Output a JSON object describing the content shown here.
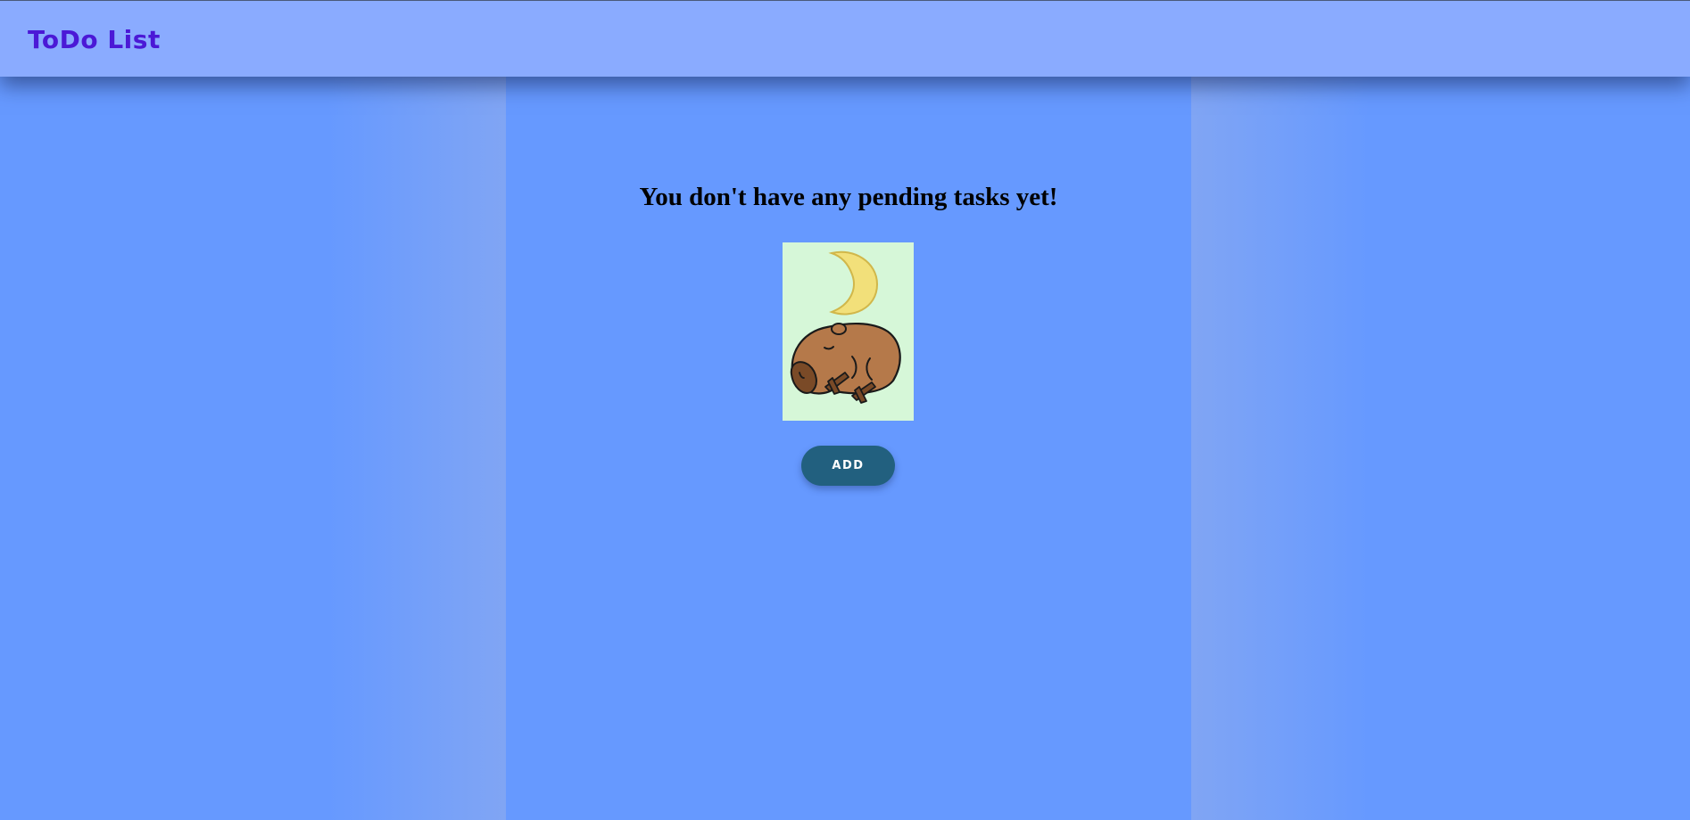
{
  "header": {
    "title": "ToDo List"
  },
  "main": {
    "empty_message": "You don't have any pending tasks yet!",
    "illustration": {
      "icon": "sleeping-capybara-moon-illustration"
    },
    "add_button_label": "ADD"
  },
  "colors": {
    "page_background": "#6699ff",
    "header_background": "#8aabff",
    "title_color": "#4b19d6",
    "button_background": "#22607f",
    "illustration_background": "#d6f7d8"
  }
}
